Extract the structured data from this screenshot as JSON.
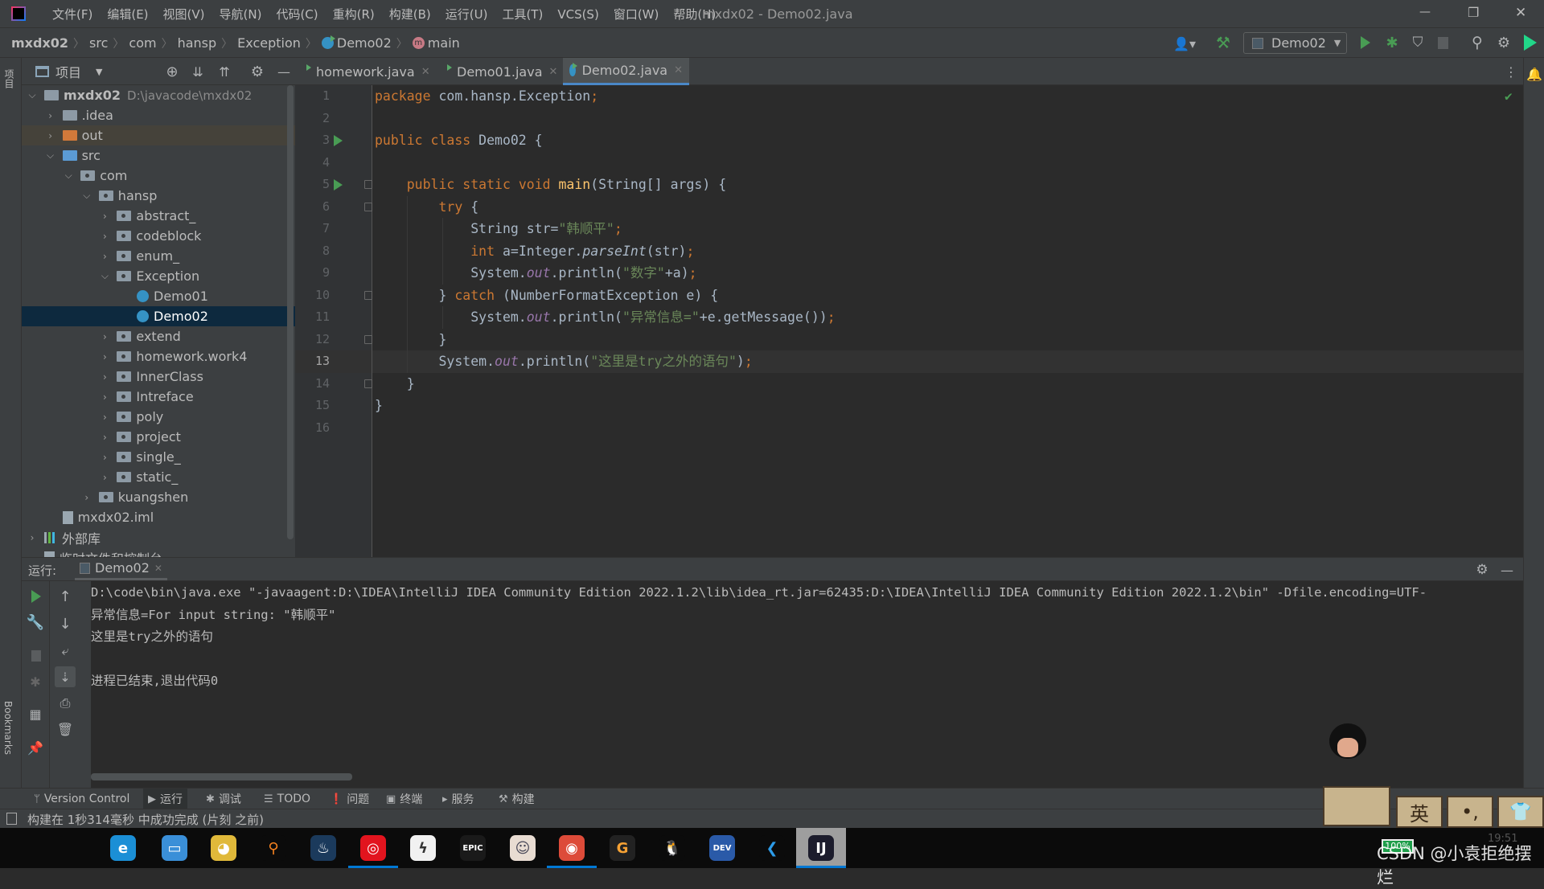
{
  "window": {
    "title": "mxdx02 - Demo02.java",
    "menu": [
      "文件(F)",
      "编辑(E)",
      "视图(V)",
      "导航(N)",
      "代码(C)",
      "重构(R)",
      "构建(B)",
      "运行(U)",
      "工具(T)",
      "VCS(S)",
      "窗口(W)",
      "帮助(H)"
    ],
    "controls": {
      "minimize": "—",
      "restore": "❐",
      "close": "✕"
    }
  },
  "breadcrumb": {
    "items": [
      "mxdx02",
      "src",
      "com",
      "hansp",
      "Exception",
      "Demo02",
      "main"
    ]
  },
  "toolbar": {
    "run_config": "Demo02",
    "icons": [
      "user-icon",
      "build-hammer-icon",
      "run-icon",
      "debug-icon",
      "coverage-icon",
      "stop-icon",
      "search-icon",
      "gear-icon",
      "toolbox-icon"
    ]
  },
  "left_strip": {
    "project_tab": "项目",
    "bookmarks_tab": "Bookmarks",
    "structure_tab": "结构"
  },
  "project": {
    "header_label": "项目",
    "tree": [
      {
        "label": "mxdx02",
        "path": "D:\\javacode\\mxdx02",
        "level": 0,
        "arrow": "open",
        "icon": "module",
        "bold": true
      },
      {
        "label": ".idea",
        "level": 1,
        "arrow": "closed",
        "icon": "folder"
      },
      {
        "label": "out",
        "level": 1,
        "arrow": "closed",
        "icon": "folder-orange",
        "excluded": true
      },
      {
        "label": "src",
        "level": 1,
        "arrow": "open",
        "icon": "folder-blue"
      },
      {
        "label": "com",
        "level": 2,
        "arrow": "open",
        "icon": "package"
      },
      {
        "label": "hansp",
        "level": 3,
        "arrow": "open",
        "icon": "package"
      },
      {
        "label": "abstract_",
        "level": 4,
        "arrow": "closed",
        "icon": "package"
      },
      {
        "label": "codeblock",
        "level": 4,
        "arrow": "closed",
        "icon": "package"
      },
      {
        "label": "enum_",
        "level": 4,
        "arrow": "closed",
        "icon": "package"
      },
      {
        "label": "Exception",
        "level": 4,
        "arrow": "open",
        "icon": "package"
      },
      {
        "label": "Demo01",
        "level": 5,
        "arrow": "none",
        "icon": "class"
      },
      {
        "label": "Demo02",
        "level": 5,
        "arrow": "none",
        "icon": "class",
        "selected": true
      },
      {
        "label": "extend",
        "level": 4,
        "arrow": "closed",
        "icon": "package"
      },
      {
        "label": "homework.work4",
        "level": 4,
        "arrow": "closed",
        "icon": "package"
      },
      {
        "label": "InnerClass",
        "level": 4,
        "arrow": "closed",
        "icon": "package"
      },
      {
        "label": "Intreface",
        "level": 4,
        "arrow": "closed",
        "icon": "package"
      },
      {
        "label": "poly",
        "level": 4,
        "arrow": "closed",
        "icon": "package"
      },
      {
        "label": "project",
        "level": 4,
        "arrow": "closed",
        "icon": "package"
      },
      {
        "label": "single_",
        "level": 4,
        "arrow": "closed",
        "icon": "package"
      },
      {
        "label": "static_",
        "level": 4,
        "arrow": "closed",
        "icon": "package"
      },
      {
        "label": "kuangshen",
        "level": 3,
        "arrow": "closed",
        "icon": "package"
      },
      {
        "label": "mxdx02.iml",
        "level": 1,
        "arrow": "none",
        "icon": "file"
      },
      {
        "label": "外部库",
        "level": 0,
        "arrow": "closed",
        "icon": "library"
      },
      {
        "label": "临时文件和控制台",
        "level": 0,
        "arrow": "none",
        "icon": "file"
      }
    ]
  },
  "editor": {
    "tabs": [
      {
        "label": "homework.java",
        "active": false
      },
      {
        "label": "Demo01.java",
        "active": false
      },
      {
        "label": "Demo02.java",
        "active": true
      }
    ],
    "current_line": 13,
    "run_marks": [
      3,
      5
    ],
    "fold_marks": [
      5,
      6,
      10,
      12,
      14
    ],
    "lines": [
      [
        [
          "package ",
          "kw"
        ],
        [
          "com.hansp.Exception",
          ""
        ],
        [
          ";",
          "kw"
        ]
      ],
      [],
      [
        [
          "public class ",
          "kw"
        ],
        [
          "Demo02 {",
          ""
        ]
      ],
      [],
      [
        [
          "    ",
          ""
        ],
        [
          "public static void ",
          "kw"
        ],
        [
          "main",
          "fn"
        ],
        [
          "(String[] args) {",
          ""
        ]
      ],
      [
        [
          "        ",
          ""
        ],
        [
          "try ",
          "kw"
        ],
        [
          "{",
          ""
        ]
      ],
      [
        [
          "            String str=",
          ""
        ],
        [
          "\"韩顺平\"",
          "str"
        ],
        [
          ";",
          "kw"
        ]
      ],
      [
        [
          "            ",
          ""
        ],
        [
          "int ",
          "kw"
        ],
        [
          "a=Integer.",
          ""
        ],
        [
          "parseInt",
          "it"
        ],
        [
          "(str)",
          ""
        ],
        [
          ";",
          "kw"
        ]
      ],
      [
        [
          "            System.",
          ""
        ],
        [
          "out",
          "fld"
        ],
        [
          ".println(",
          ""
        ],
        [
          "\"数字\"",
          "str"
        ],
        [
          "+a)",
          ""
        ],
        [
          ";",
          "kw"
        ]
      ],
      [
        [
          "        } ",
          ""
        ],
        [
          "catch ",
          "kw"
        ],
        [
          "(NumberFormatException e) {",
          ""
        ]
      ],
      [
        [
          "            System.",
          ""
        ],
        [
          "out",
          "fld"
        ],
        [
          ".println(",
          ""
        ],
        [
          "\"异常信息=\"",
          "str"
        ],
        [
          "+e.getMessage())",
          ""
        ],
        [
          ";",
          "kw"
        ]
      ],
      [
        [
          "        }",
          ""
        ]
      ],
      [
        [
          "        System.",
          ""
        ],
        [
          "out",
          "fld"
        ],
        [
          ".println(",
          ""
        ],
        [
          "\"这里是try之外的语句\"",
          "str"
        ],
        [
          ")",
          ""
        ],
        [
          ";",
          "kw"
        ]
      ],
      [
        [
          "    }",
          ""
        ]
      ],
      [
        [
          "}",
          ""
        ]
      ],
      []
    ]
  },
  "run_panel": {
    "label": "运行:",
    "tab": "Demo02",
    "output": [
      "D:\\code\\bin\\java.exe \"-javaagent:D:\\IDEA\\IntelliJ IDEA Community Edition 2022.1.2\\lib\\idea_rt.jar=62435:D:\\IDEA\\IntelliJ IDEA Community Edition 2022.1.2\\bin\" -Dfile.encoding=UTF-",
      "异常信息=For input string: \"韩顺平\"",
      "这里是try之外的语句",
      "",
      "进程已结束,退出代码0"
    ]
  },
  "bottom_tools": [
    {
      "label": "Version Control",
      "icon": "branch-icon",
      "glyph": "ᛘ"
    },
    {
      "label": "运行",
      "icon": "run-icon",
      "glyph": "▶",
      "active": true
    },
    {
      "label": "调试",
      "icon": "bug-icon",
      "glyph": "✱"
    },
    {
      "label": "TODO",
      "icon": "list-icon",
      "glyph": "☰"
    },
    {
      "label": "问题",
      "icon": "problem-icon",
      "glyph": "❗"
    },
    {
      "label": "终端",
      "icon": "terminal-icon",
      "glyph": "▣"
    },
    {
      "label": "服务",
      "icon": "services-icon",
      "glyph": "▸"
    },
    {
      "label": "构建",
      "icon": "hammer-icon",
      "glyph": "⚒"
    }
  ],
  "status": {
    "message": "构建在 1秒314毫秒 中成功完成 (片刻 之前)"
  },
  "overlay": {
    "ime_key": "英",
    "battery": "100%",
    "clock": "19:51",
    "watermark": "CSDN @小袁拒绝摆烂"
  },
  "taskbar": [
    {
      "name": "edge",
      "color": "#1b8fd6",
      "glyph": "e"
    },
    {
      "name": "this-pc",
      "color": "#3a8fd8",
      "glyph": "▭"
    },
    {
      "name": "raccoon-app",
      "color": "#e0b93a",
      "glyph": "◕"
    },
    {
      "name": "search-app",
      "color": "#0b0b0b",
      "glyph": "⚲",
      "fg": "#f58220"
    },
    {
      "name": "steam",
      "color": "#1b3a5c",
      "glyph": "♨"
    },
    {
      "name": "netease-music",
      "color": "#e2141e",
      "glyph": "◎",
      "open": true
    },
    {
      "name": "lightning-app",
      "color": "#f1f1f1",
      "glyph": "ϟ",
      "fg": "#333"
    },
    {
      "name": "epic-games",
      "color": "#1a1a1a",
      "glyph": "EPIC"
    },
    {
      "name": "anime-app",
      "color": "#e8dcd2",
      "glyph": "☺",
      "fg": "#445"
    },
    {
      "name": "chrome",
      "color": "#dd4b39",
      "glyph": "◉",
      "open": true
    },
    {
      "name": "g-app",
      "color": "#222",
      "glyph": "G",
      "fg": "#f7a234"
    },
    {
      "name": "qq",
      "color": "#0b0b0b",
      "glyph": "🐧"
    },
    {
      "name": "dev-cpp",
      "color": "#2a5aa8",
      "glyph": "DEV"
    },
    {
      "name": "vscode",
      "color": "#0b0b0b",
      "glyph": "❮",
      "fg": "#2c9be8"
    },
    {
      "name": "intellij",
      "color": "#1c1c2c",
      "glyph": "IJ",
      "active": true,
      "open": true
    }
  ],
  "colors": {
    "keyword": "#cc7832",
    "string": "#6a8759",
    "field": "#9876aa",
    "method": "#ffc66d",
    "selection": "#0d293e",
    "accent": "#4a88c7",
    "run_green": "#499c54"
  }
}
